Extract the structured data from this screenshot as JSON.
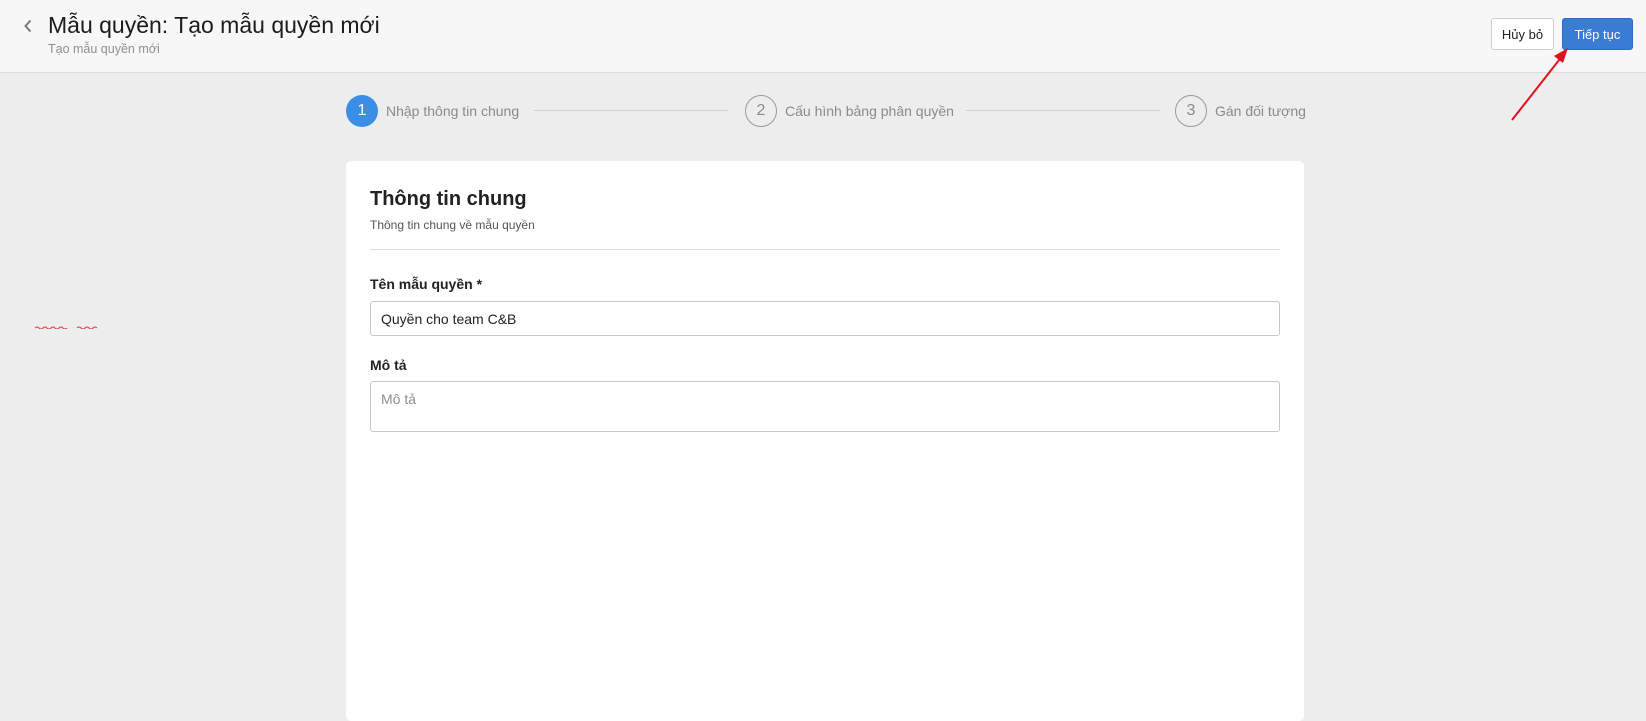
{
  "header": {
    "title": "Mẫu quyền: Tạo mẫu quyền mới",
    "subtitle": "Tạo mẫu quyền mới",
    "cancel_label": "Hủy bỏ",
    "continue_label": "Tiếp tục"
  },
  "stepper": {
    "steps": [
      {
        "number": "1",
        "label": "Nhập thông tin chung",
        "state": "active"
      },
      {
        "number": "2",
        "label": "Cấu hình bảng phân quyền",
        "state": "inactive"
      },
      {
        "number": "3",
        "label": "Gán đối tượng",
        "state": "inactive"
      }
    ]
  },
  "form": {
    "title": "Thông tin chung",
    "subtitle": "Thông tin chung về mẫu quyền",
    "name_label": "Tên mẫu quyền *",
    "name_value": "Quyền cho team C&B",
    "description_label": "Mô tả",
    "description_placeholder": "Mô tả",
    "description_value": ""
  },
  "icons": {
    "back": "chevron-left-icon",
    "annotation": "red-arrow-icon"
  },
  "colors": {
    "primary": "#3a7bd5",
    "step_active": "#3a8ee6",
    "annotation": "#e3101b"
  }
}
